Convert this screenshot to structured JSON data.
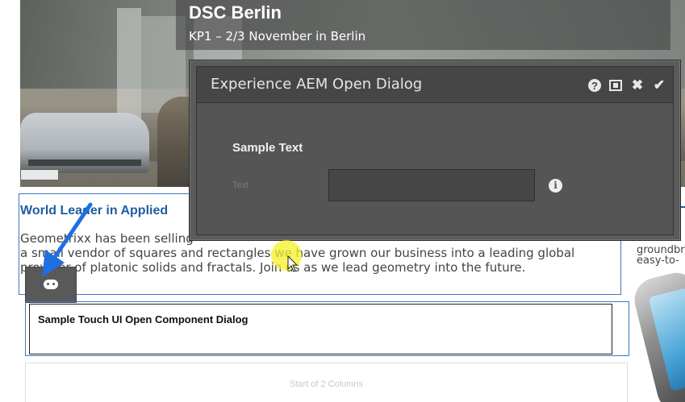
{
  "hero": {
    "title": "DSC Berlin",
    "subtitle": "KP1 – 2/3 November in Berlin"
  },
  "text_component": {
    "heading": "World Leader in Applied",
    "body_lines": [
      "Geometrixx has been selling",
      "a small vendor of squares and rectangles we have grown our business into a leading global",
      "provider of platonic solids and fractals. Join us as we lead geometry into the future."
    ]
  },
  "right_column": {
    "lines": [
      "groundbr",
      "easy-to-"
    ]
  },
  "edit_toolbar": {
    "icon": "gamepad-icon"
  },
  "sample_component": {
    "title": "Sample Touch UI Open Component Dialog"
  },
  "columns_component": {
    "label": "Start of 2 Columns"
  },
  "dialog": {
    "title": "Experience AEM Open Dialog",
    "actions": [
      {
        "name": "help",
        "icon": "help-icon",
        "glyph": "?"
      },
      {
        "name": "fullscreen",
        "icon": "fullscreen-icon",
        "glyph": "⌖"
      },
      {
        "name": "close",
        "icon": "close-icon",
        "glyph": "✖"
      },
      {
        "name": "done",
        "icon": "checkmark-icon",
        "glyph": "✔"
      }
    ],
    "section_title": "Sample Text",
    "field": {
      "label": "Text",
      "value": "",
      "info_glyph": "i"
    }
  },
  "colors": {
    "dialog_bg": "#5b5b5b",
    "dialog_header": "#464646",
    "selection_border": "#3a78c3",
    "heading_link": "#1d5fa0",
    "cursor_highlight": "#f5f028"
  }
}
